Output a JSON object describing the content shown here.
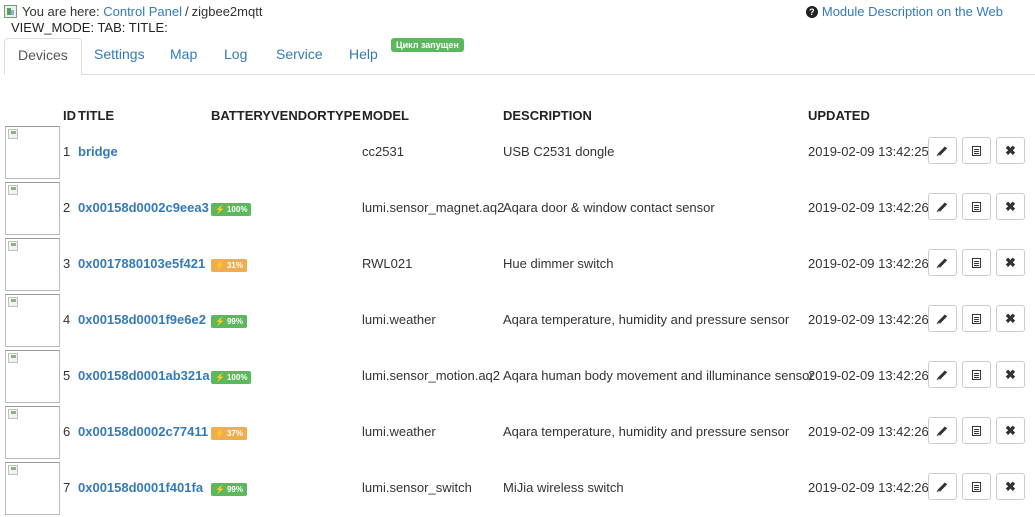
{
  "breadcrumb": {
    "prefix": "You are here:",
    "control_panel": "Control Panel",
    "separator": "/",
    "current": "zigbee2mqtt"
  },
  "view_mode": "VIEW_MODE: TAB: TITLE:",
  "help_link": {
    "icon": "question-circle-icon",
    "label": "Module Description on the Web"
  },
  "tabs": [
    {
      "label": "Devices",
      "active": true
    },
    {
      "label": "Settings",
      "active": false
    },
    {
      "label": "Map",
      "active": false
    },
    {
      "label": "Log",
      "active": false
    },
    {
      "label": "Service",
      "active": false
    },
    {
      "label": "Help",
      "active": false
    }
  ],
  "status_badge": "Цикл запущен",
  "table": {
    "headers": {
      "id": "ID",
      "title": "TITLE",
      "battery": "BATTERY",
      "vendor": "VENDOR",
      "type": "TYPE",
      "model": "MODEL",
      "description": "DESCRIPTION",
      "updated": "UPDATED"
    },
    "rows": [
      {
        "id": "1",
        "title": "bridge",
        "battery": "",
        "model": "cc2531",
        "description": "USB C2531 dongle",
        "updated": "2019-02-09 13:42:25"
      },
      {
        "id": "2",
        "title": "0x00158d0002c9eea3",
        "battery": "100%",
        "model": "lumi.sensor_magnet.aq2",
        "description": "Aqara door & window contact sensor",
        "updated": "2019-02-09 13:42:26"
      },
      {
        "id": "3",
        "title": "0x0017880103e5f421",
        "battery": "31%",
        "model": "RWL021",
        "description": "Hue dimmer switch",
        "updated": "2019-02-09 13:42:26"
      },
      {
        "id": "4",
        "title": "0x00158d0001f9e6e2",
        "battery": "99%",
        "model": "lumi.weather",
        "description": "Aqara temperature, humidity and pressure sensor",
        "updated": "2019-02-09 13:42:26"
      },
      {
        "id": "5",
        "title": "0x00158d0001ab321a",
        "battery": "100%",
        "model": "lumi.sensor_motion.aq2",
        "description": "Aqara human body movement and illuminance sensor",
        "updated": "2019-02-09 13:42:26"
      },
      {
        "id": "6",
        "title": "0x00158d0002c77411",
        "battery": "37%",
        "model": "lumi.weather",
        "description": "Aqara temperature, humidity and pressure sensor",
        "updated": "2019-02-09 13:42:26"
      },
      {
        "id": "7",
        "title": "0x00158d0001f401fa",
        "battery": "99%",
        "model": "lumi.sensor_switch",
        "description": "MiJia wireless switch",
        "updated": "2019-02-09 13:42:26"
      }
    ]
  },
  "colors": {
    "link": "#337ab7",
    "battery_high": "#5cb85c",
    "battery_low": "#f0ad4e"
  },
  "icons": {
    "bolt": "⚡",
    "edit": "pencil-icon",
    "details": "list-icon",
    "delete": "close-icon"
  }
}
